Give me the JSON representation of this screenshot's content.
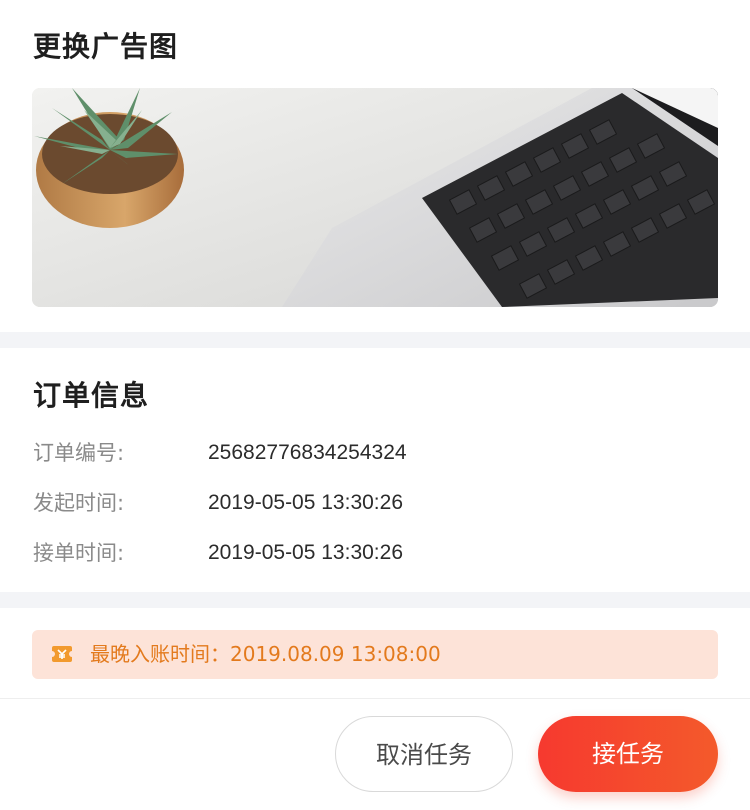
{
  "ad_section": {
    "title": "更换广告图",
    "image_icon": "laptop-and-succulent-photo"
  },
  "order_info": {
    "title": "订单信息",
    "rows": [
      {
        "label": "订单编号:",
        "value": "25682776834254324"
      },
      {
        "label": "发起时间:",
        "value": "2019-05-05 13:30:26"
      },
      {
        "label": "接单时间:",
        "value": "2019-05-05 13:30:26"
      }
    ]
  },
  "notice": {
    "icon": "ticket-icon",
    "text": "最晚入账时间：2019.08.09  13:08:00",
    "color": "#e37a1d",
    "background": "#fde3d8"
  },
  "actions": {
    "cancel_label": "取消任务",
    "accept_label": "接任务",
    "accent_color": "#f6392f"
  }
}
